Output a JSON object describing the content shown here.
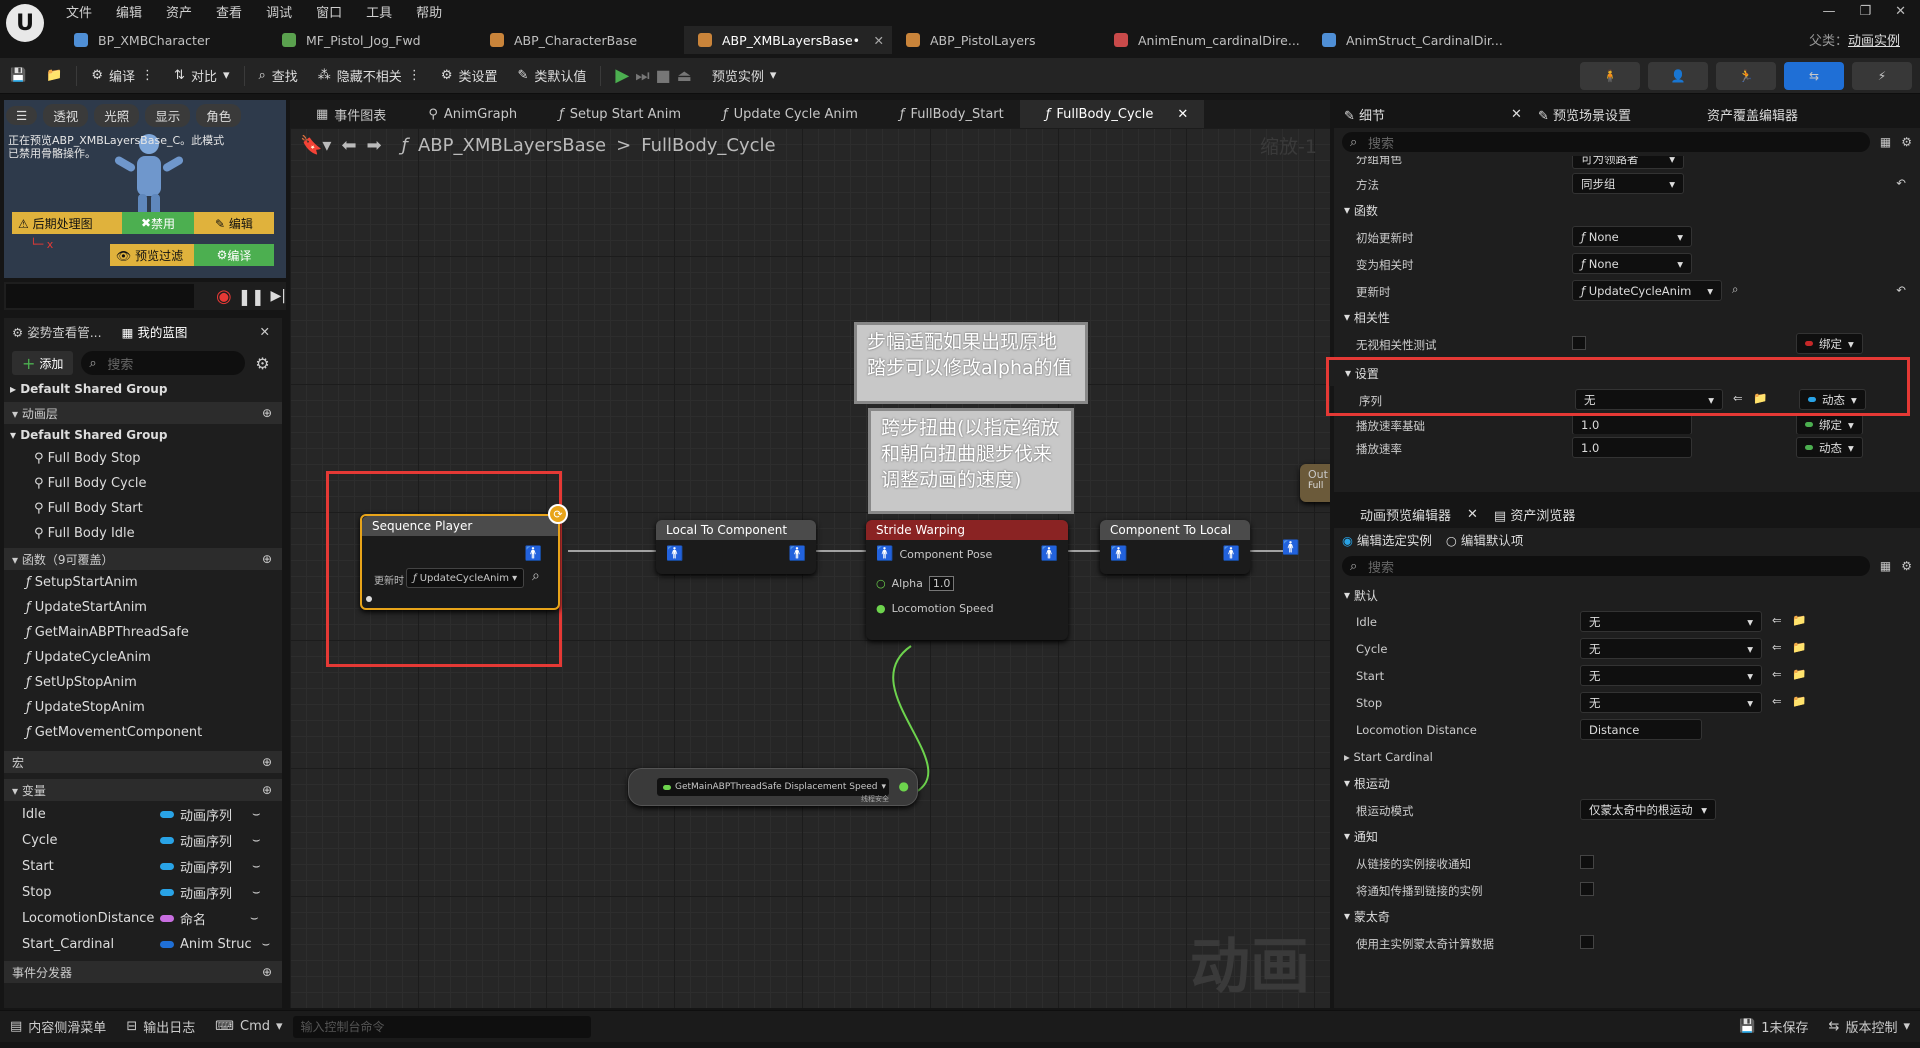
{
  "menu": [
    "文件",
    "编辑",
    "资产",
    "查看",
    "调试",
    "窗口",
    "工具",
    "帮助"
  ],
  "doc_tabs": [
    {
      "label": "BP_XMBCharacter",
      "color": "#4f8fd6"
    },
    {
      "label": "MF_Pistol_Jog_Fwd",
      "color": "#5aa14e"
    },
    {
      "label": "ABP_CharacterBase",
      "color": "#c9843a"
    },
    {
      "label": "ABP_XMBLayersBase•",
      "color": "#c9843a",
      "active": true
    },
    {
      "label": "ABP_PistolLayers",
      "color": "#c9843a"
    },
    {
      "label": "AnimEnum_cardinalDire...",
      "color": "#c94a4a"
    },
    {
      "label": "AnimStruct_CardinalDir...",
      "color": "#4f8fd6"
    }
  ],
  "parent": {
    "label": "父类：",
    "value": "动画实例"
  },
  "toolbar": {
    "compile": "编译",
    "diff": "对比",
    "find": "查找",
    "hide_unrelated": "隐藏不相关",
    "class_settings": "类设置",
    "class_defaults": "类默认值",
    "preview_instance": "预览实例"
  },
  "viewport": {
    "buttons": [
      "透视",
      "光照",
      "显示",
      "角色"
    ],
    "message": "正在预览ABP_XMBLayersBase_C。此模式已禁用骨骼操作。",
    "row1": [
      "后期处理图",
      "禁用",
      "编辑"
    ],
    "row2": [
      "预览过滤",
      "编译"
    ]
  },
  "left_panel": {
    "tabs": [
      "姿势查看管...",
      "我的蓝图"
    ],
    "add": "添加",
    "search_placeholder": "搜索",
    "group1": "Default Shared Group",
    "anim_layers": "动画层",
    "group2": "Default Shared Group",
    "layers": [
      "Full Body Stop",
      "Full Body Cycle",
      "Full Body Start",
      "Full Body Idle"
    ],
    "functions_header": "函数（9可覆盖）",
    "functions": [
      "SetupStartAnim",
      "UpdateStartAnim",
      "GetMainABPThreadSafe",
      "UpdateCycleAnim",
      "SetUpStopAnim",
      "UpdateStopAnim",
      "GetMovementComponent"
    ],
    "macros": "宏",
    "variables_header": "变量",
    "variables": [
      {
        "name": "Idle",
        "type": "动画序列",
        "color": "#29a3e6"
      },
      {
        "name": "Cycle",
        "type": "动画序列",
        "color": "#29a3e6"
      },
      {
        "name": "Start",
        "type": "动画序列",
        "color": "#29a3e6"
      },
      {
        "name": "Stop",
        "type": "动画序列",
        "color": "#29a3e6"
      },
      {
        "name": "LocomotionDistance",
        "type": "命名",
        "color": "#c86ee0"
      },
      {
        "name": "Start_Cardinal",
        "type": "Anim Struc",
        "color": "#1f6fd6"
      }
    ],
    "event_dispatchers": "事件分发器"
  },
  "graph_tabs": [
    "事件图表",
    "AnimGraph",
    "Setup Start Anim",
    "Update Cycle Anim",
    "FullBody_Start",
    "FullBody_Cycle"
  ],
  "breadcrumb": {
    "root": "ABP_XMBLayersBase",
    "sep": ">",
    "current": "FullBody_Cycle"
  },
  "zoom": "缩放-1",
  "watermark": "动画",
  "nodes": {
    "seq_player": {
      "title": "Sequence Player",
      "label": "更新时",
      "fn": "UpdateCycleAnim"
    },
    "l2c": {
      "title": "Local To Component"
    },
    "stride": {
      "title": "Stride Warping",
      "pose": "Component Pose",
      "alpha_label": "Alpha",
      "alpha": "1.0",
      "speed": "Locomotion Speed"
    },
    "c2l": {
      "title": "Component To Local"
    },
    "out": {
      "title": "Out",
      "sub": "Full"
    },
    "getter": {
      "label": "GetMainABPThreadSafe Displacement Speed",
      "tag": "线程安全"
    }
  },
  "comments": {
    "c1": "步幅适配如果出现原地踏步可以修改alpha的值",
    "c2": "跨步扭曲(以指定缩放和朝向扭曲腿步伐来调整动画的速度)"
  },
  "details": {
    "tabs": [
      "细节",
      "预览场景设置",
      "资产覆盖编辑器"
    ],
    "search": "搜索",
    "cut_row": {
      "label": "分组角色",
      "value": "可为领路者"
    },
    "method": {
      "label": "方法",
      "value": "同步组"
    },
    "functions_header": "函数",
    "initial_update": {
      "label": "初始更新时",
      "value": "None"
    },
    "become_relevant": {
      "label": "变为相关时",
      "value": "None"
    },
    "on_update": {
      "label": "更新时",
      "value": "UpdateCycleAnim"
    },
    "relevancy_header": "相关性",
    "ignore_relevancy": {
      "label": "无视相关性测试",
      "bind": "绑定"
    },
    "settings_header": "设置",
    "sequence": {
      "label": "序列",
      "value": "无",
      "bind": "动态"
    },
    "play_rate_basis": {
      "label": "播放速率基础",
      "value": "1.0",
      "bind": "绑定"
    },
    "play_rate": {
      "label": "播放速率",
      "value": "1.0",
      "bind": "动态"
    }
  },
  "anim_preview": {
    "tabs": [
      "动画预览编辑器",
      "资产浏览器"
    ],
    "radio1": "编辑选定实例",
    "radio2": "编辑默认项",
    "search": "搜索",
    "default_header": "默认",
    "rows": [
      {
        "label": "Idle",
        "value": "无"
      },
      {
        "label": "Cycle",
        "value": "无"
      },
      {
        "label": "Start",
        "value": "无"
      },
      {
        "label": "Stop",
        "value": "无"
      }
    ],
    "loco_distance": {
      "label": "Locomotion Distance",
      "value": "Distance"
    },
    "start_cardinal": "Start Cardinal",
    "root_motion_header": "根运动",
    "root_motion_mode": {
      "label": "根运动模式",
      "value": "仅蒙太奇中的根运动"
    },
    "notify_header": "通知",
    "notify1": "从链接的实例接收通知",
    "notify2": "将通知传播到链接的实例",
    "montage_header": "蒙太奇",
    "montage1": "使用主实例蒙太奇计算数据"
  },
  "statusbar": {
    "content_drawer": "内容侧滑菜单",
    "output_log": "输出日志",
    "cmd": "Cmd",
    "cmd_placeholder": "输入控制台命令",
    "unsaved": "1未保存",
    "source_control": "版本控制"
  }
}
